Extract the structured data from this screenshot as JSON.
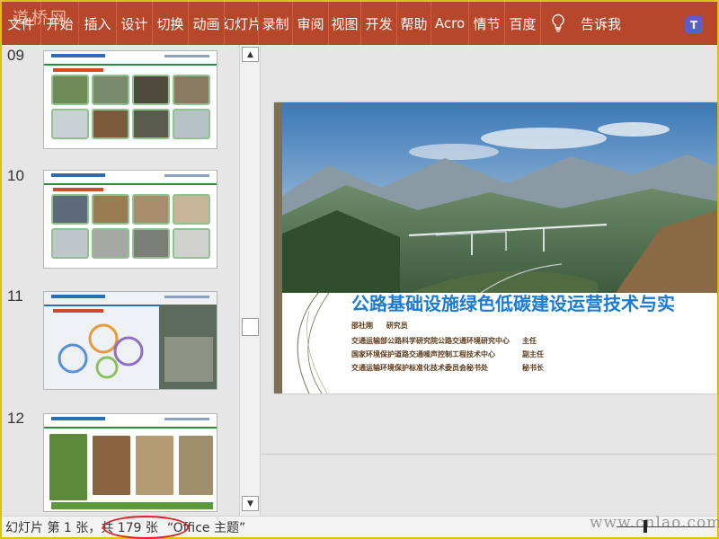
{
  "ribbon": {
    "tabs": [
      "文件",
      "开始",
      "插入",
      "设计",
      "切换",
      "动画",
      "幻灯片",
      "录制",
      "审阅",
      "视图",
      "开发",
      "帮助",
      "Acro",
      "情节",
      "百度"
    ],
    "tell_me": "告诉我",
    "watermark": "道桥网",
    "teams_icon_letter": "T"
  },
  "thumbnails": {
    "numbers": [
      "09",
      "10",
      "11",
      "12"
    ]
  },
  "slide": {
    "title": "公路基础设施绿色低碳建设运营技术与实",
    "presenter_name": "邵社刚",
    "presenter_title": "研究员",
    "affiliations": [
      {
        "org": "交通运输部公路科学研究院公路交通环境研究中心",
        "role": "主任"
      },
      {
        "org": "国家环境保护道路交通噪声控制工程技术中心",
        "role": "副主任"
      },
      {
        "org": "交通运输环境保护标准化技术委员会秘书处",
        "role": "秘书长"
      }
    ]
  },
  "status_bar": {
    "slide_info": "幻灯片 第 1 张，共 179 张",
    "theme": "“Office 主题”",
    "watermark": "www.cnlao.com"
  },
  "colors": {
    "ribbon": "#b7472a",
    "title": "#1a7bd0",
    "highlight_circle": "#e0202a",
    "frame": "#e0c200"
  }
}
